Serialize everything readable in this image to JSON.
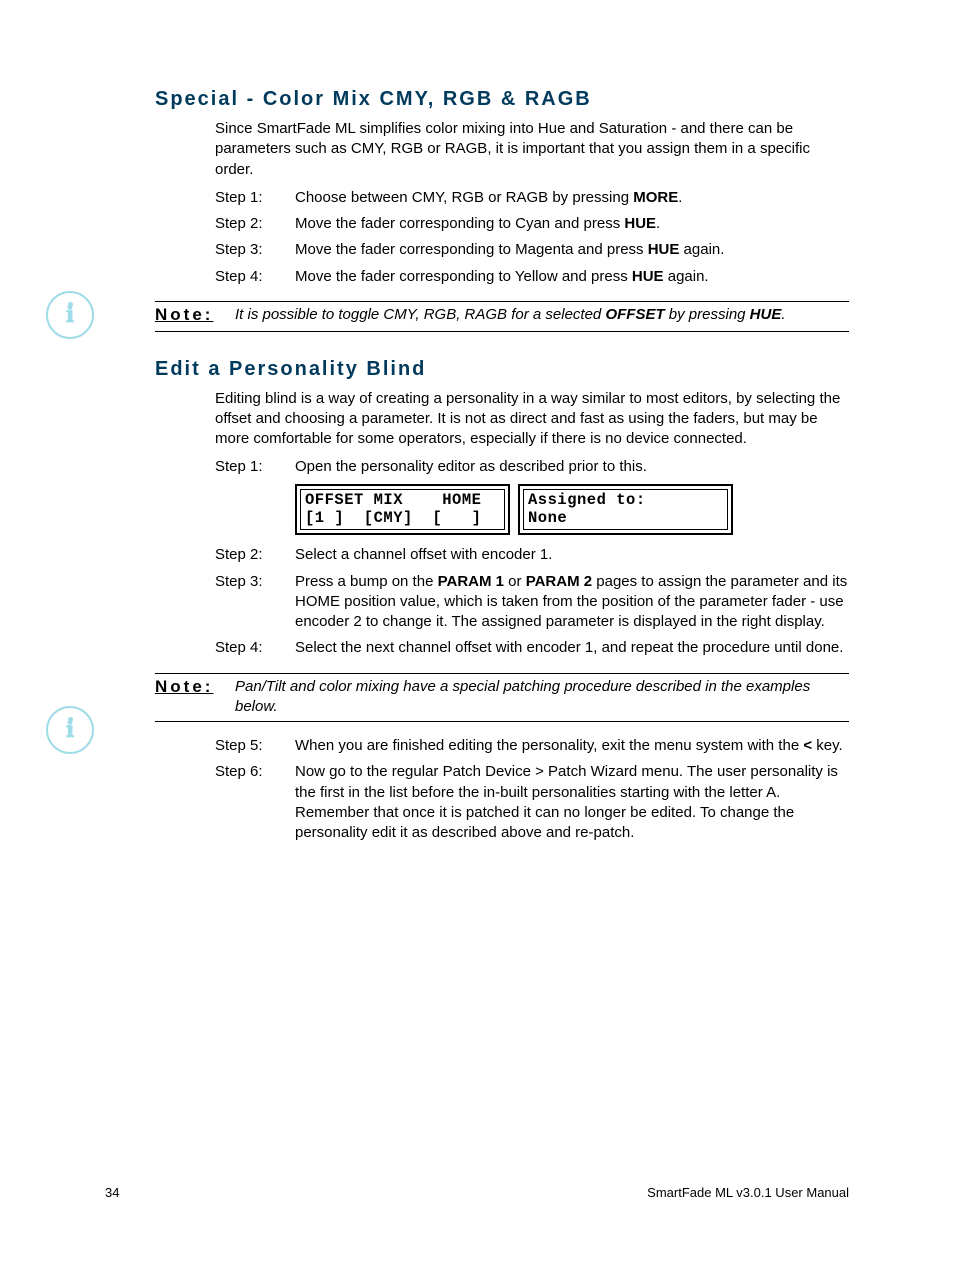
{
  "section1": {
    "heading": "Special - Color Mix CMY, RGB & RAGB",
    "intro": "Since SmartFade ML simplifies color mixing into Hue and Saturation - and there can be parameters such as CMY, RGB or RAGB, it is important that you assign them in a specific order.",
    "steps": [
      {
        "label": "Step 1:",
        "preBold": "Choose between CMY, RGB or RAGB by pressing ",
        "bold": "MORE",
        "postBold": "."
      },
      {
        "label": "Step 2:",
        "preBold": "Move the fader corresponding to Cyan and press ",
        "bold": "HUE",
        "postBold": "."
      },
      {
        "label": "Step 3:",
        "preBold": "Move the fader corresponding to Magenta and press ",
        "bold": "HUE",
        "postBold": " again."
      },
      {
        "label": "Step 4:",
        "preBold": "Move the fader corresponding to Yellow and press ",
        "bold": "HUE",
        "postBold": " again."
      }
    ]
  },
  "note1": {
    "label": "Note:",
    "text_pre": "It is possible to toggle CMY, RGB, RAGB for a selected ",
    "bold1": "OFFSET",
    "mid": " by pressing ",
    "bold2": "HUE",
    "post": "."
  },
  "section2": {
    "heading": "Edit a Personality Blind",
    "intro": "Editing blind is a way of creating a personality in a way similar to most editors, by selecting the offset and choosing a parameter. It is not as direct and fast as using the faders, but may be more comfortable for some operators, especially if there is no device connected.",
    "step1": {
      "label": "Step 1:",
      "text": "Open the personality editor as described prior to this."
    },
    "lcd": {
      "left_line1": "OFFSET MIX    HOME",
      "left_line2": "[1 ]  [CMY]  [   ]",
      "right_line1": "Assigned to:",
      "right_line2": "None"
    },
    "step2": {
      "label": "Step 2:",
      "text": "Select a channel offset with encoder 1."
    },
    "step3": {
      "label": "Step 3:",
      "pre": "Press a bump on the ",
      "b1": "PARAM 1",
      "mid": " or ",
      "b2": "PARAM 2",
      "post": " pages to assign the parameter and its HOME position value, which is taken from the position of the parameter fader - use encoder 2 to change it. The assigned parameter is displayed in the right display."
    },
    "step4": {
      "label": "Step 4:",
      "text": "Select the next channel offset with encoder 1, and repeat the procedure until done."
    }
  },
  "note2": {
    "label": "Note:",
    "text": "Pan/Tilt and color mixing have a special patching procedure described in the examples below."
  },
  "section2b": {
    "step5": {
      "label": "Step 5:",
      "pre": "When you are finished editing the personality, exit the menu system with the ",
      "bold": "<",
      "post": " key."
    },
    "step6": {
      "label": "Step 6:",
      "text": "Now go to the regular Patch Device > Patch Wizard menu.  The user personality is the first in the list before the in-built personalities starting with the letter A. Remember that once it is patched it can no longer be edited. To change the personality edit it as described above and re-patch."
    }
  },
  "footer": {
    "pageNum": "34",
    "docTitle": "SmartFade ML v3.0.1 User Manual"
  }
}
